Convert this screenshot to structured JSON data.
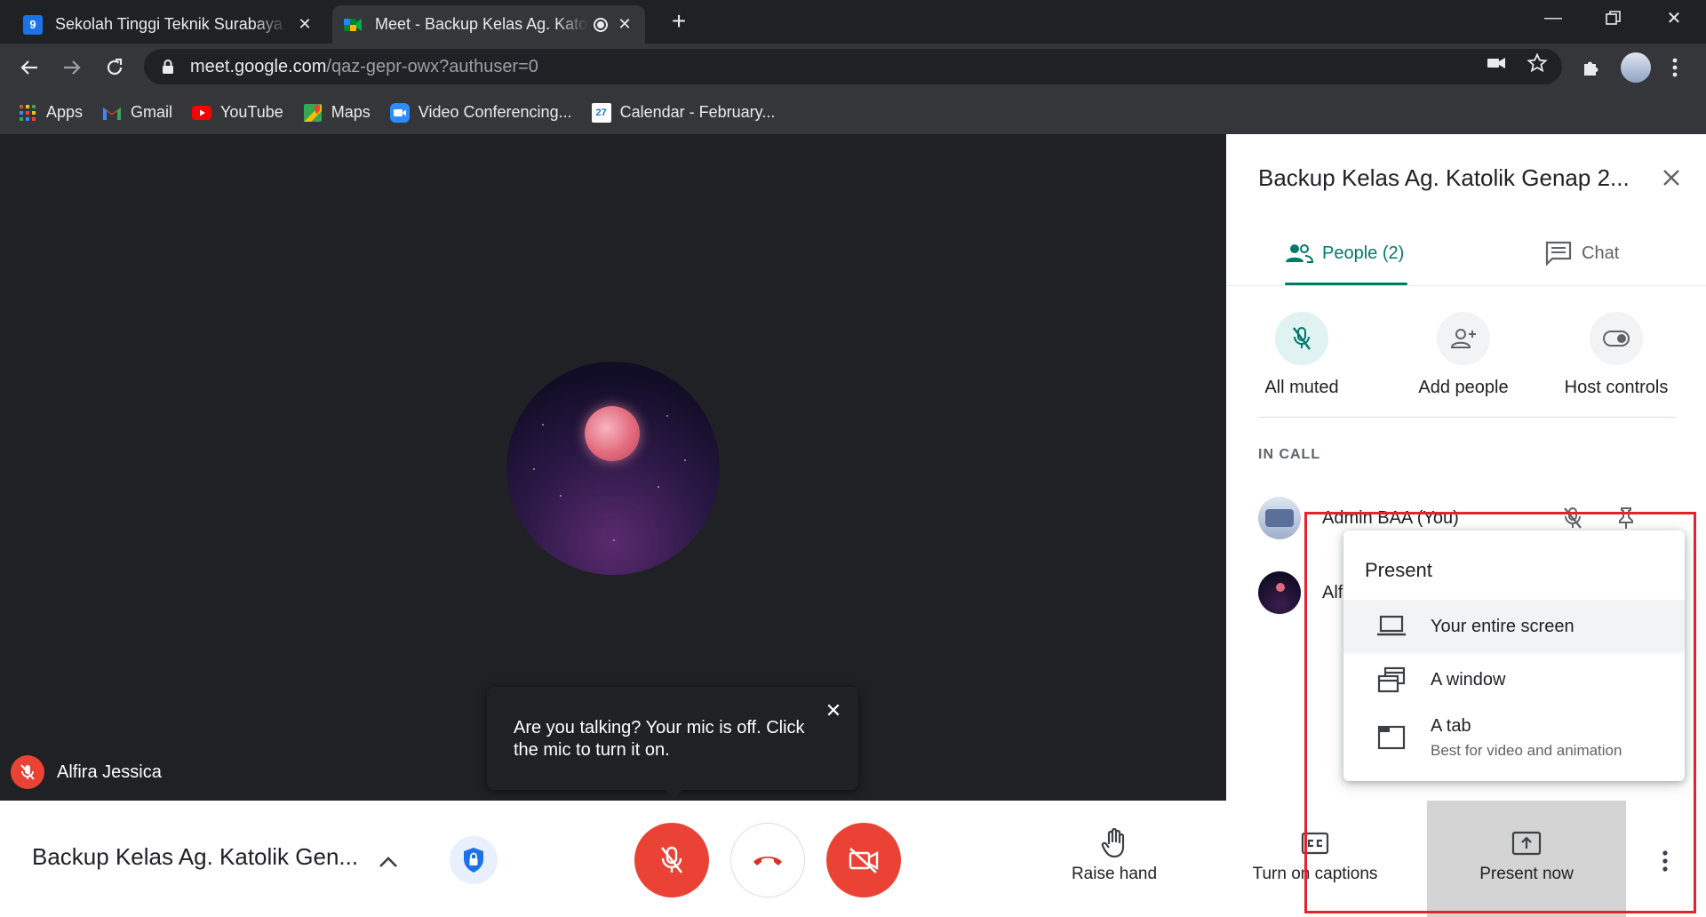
{
  "browser": {
    "tabs": [
      {
        "title": "Sekolah Tinggi Teknik Surabaya -",
        "favicon": "calendar-9-icon",
        "active": false
      },
      {
        "title": "Meet - Backup Kelas Ag. Katolik",
        "favicon": "google-meet-icon",
        "active": true,
        "recording": true
      }
    ],
    "url_host": "meet.google.com",
    "url_path": "/qaz-gepr-owx?authuser=0",
    "bookmarks": [
      {
        "label": "Apps",
        "icon": "apps-grid-icon"
      },
      {
        "label": "Gmail",
        "icon": "gmail-icon"
      },
      {
        "label": "YouTube",
        "icon": "youtube-icon"
      },
      {
        "label": "Maps",
        "icon": "maps-icon"
      },
      {
        "label": "Video Conferencing...",
        "icon": "zoom-icon"
      },
      {
        "label": "Calendar - February...",
        "icon": "calendar-icon"
      }
    ]
  },
  "meet": {
    "tile_name": "Alfira Jessica",
    "tooltip": "Are you talking? Your mic is off. Click the mic to turn it on.",
    "panel": {
      "title": "Backup Kelas Ag. Katolik Genap 2...",
      "tab_people": "People (2)",
      "tab_chat": "Chat",
      "host_buttons": [
        "All muted",
        "Add people",
        "Host controls"
      ],
      "in_call_label": "IN CALL",
      "people": [
        "Admin BAA (You)",
        "Alf"
      ]
    },
    "present_menu": {
      "title": "Present",
      "items": [
        {
          "label": "Your entire screen",
          "sub": ""
        },
        {
          "label": "A window",
          "sub": ""
        },
        {
          "label": "A tab",
          "sub": "Best for video and animation"
        }
      ]
    },
    "bottom": {
      "meeting_title": "Backup Kelas Ag. Katolik Gen...",
      "raise_hand": "Raise hand",
      "captions": "Turn on captions",
      "present_now": "Present now"
    }
  },
  "colors": {
    "meet_red": "#ea4335",
    "meet_teal": "#00796b",
    "annotation_red": "#e0262c"
  }
}
